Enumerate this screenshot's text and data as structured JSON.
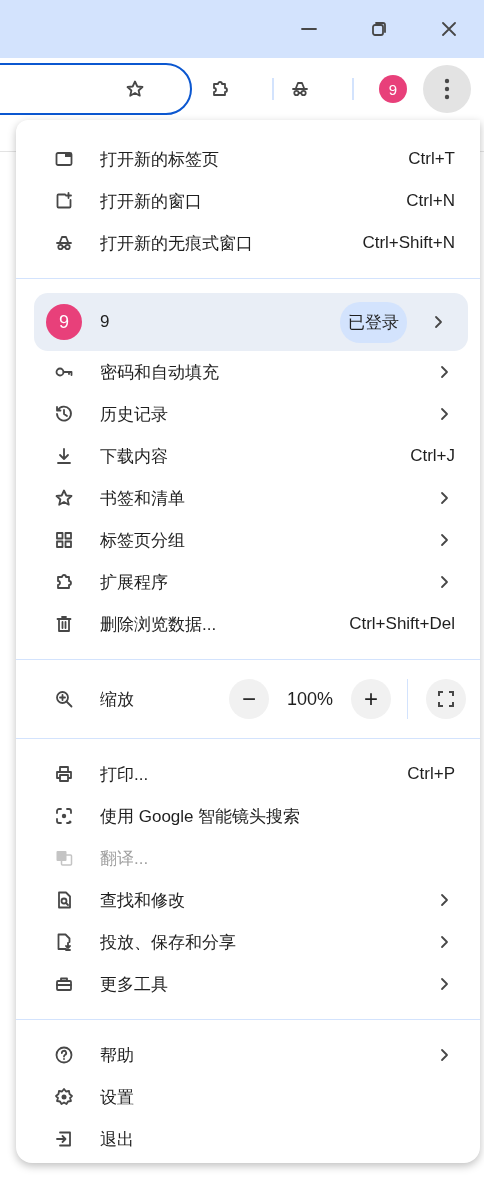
{
  "toolbar": {
    "avatar": "9",
    "menu_button_pressed": true
  },
  "menu": {
    "sections": [
      {
        "items": [
          {
            "kind": "item",
            "label": "打开新的标签页",
            "shortcut": "Ctrl+T",
            "submenu": false,
            "disabled": false
          },
          {
            "kind": "item",
            "label": "打开新的窗口",
            "shortcut": "Ctrl+N",
            "submenu": false,
            "disabled": false
          },
          {
            "kind": "item",
            "label": "打开新的无痕式窗口",
            "shortcut": "Ctrl+Shift+N",
            "submenu": false,
            "disabled": false
          }
        ]
      },
      {
        "items": [
          {
            "kind": "profile",
            "avatar": "9",
            "name": "9",
            "badge": "已登录",
            "submenu": true
          },
          {
            "kind": "item",
            "label": "密码和自动填充",
            "submenu": true,
            "disabled": false
          },
          {
            "kind": "item",
            "label": "历史记录",
            "submenu": true,
            "disabled": false
          },
          {
            "kind": "item",
            "label": "下载内容",
            "shortcut": "Ctrl+J",
            "submenu": false,
            "disabled": false
          },
          {
            "kind": "item",
            "label": "书签和清单",
            "submenu": true,
            "disabled": false
          },
          {
            "kind": "item",
            "label": "标签页分组",
            "submenu": true,
            "disabled": false
          },
          {
            "kind": "item",
            "label": "扩展程序",
            "submenu": true,
            "disabled": false
          },
          {
            "kind": "item",
            "label": "删除浏览数据...",
            "shortcut": "Ctrl+Shift+Del",
            "submenu": false,
            "disabled": false
          }
        ]
      },
      {
        "items": [
          {
            "kind": "zoom",
            "label": "缩放",
            "minus": "−",
            "value": "100%",
            "plus": "+"
          }
        ]
      },
      {
        "items": [
          {
            "kind": "item",
            "label": "打印...",
            "shortcut": "Ctrl+P",
            "submenu": false,
            "disabled": false
          },
          {
            "kind": "item",
            "label": "使用 Google 智能镜头搜索",
            "submenu": false,
            "disabled": false
          },
          {
            "kind": "item",
            "label": "翻译...",
            "submenu": false,
            "disabled": true
          },
          {
            "kind": "item",
            "label": "查找和修改",
            "submenu": true,
            "disabled": false
          },
          {
            "kind": "item",
            "label": "投放、保存和分享",
            "submenu": true,
            "disabled": false
          },
          {
            "kind": "item",
            "label": "更多工具",
            "submenu": true,
            "disabled": false
          }
        ]
      },
      {
        "items": [
          {
            "kind": "item",
            "label": "帮助",
            "submenu": true,
            "disabled": false
          },
          {
            "kind": "item",
            "label": "设置",
            "submenu": false,
            "disabled": false
          },
          {
            "kind": "item",
            "label": "退出",
            "submenu": false,
            "disabled": false
          }
        ]
      }
    ]
  }
}
